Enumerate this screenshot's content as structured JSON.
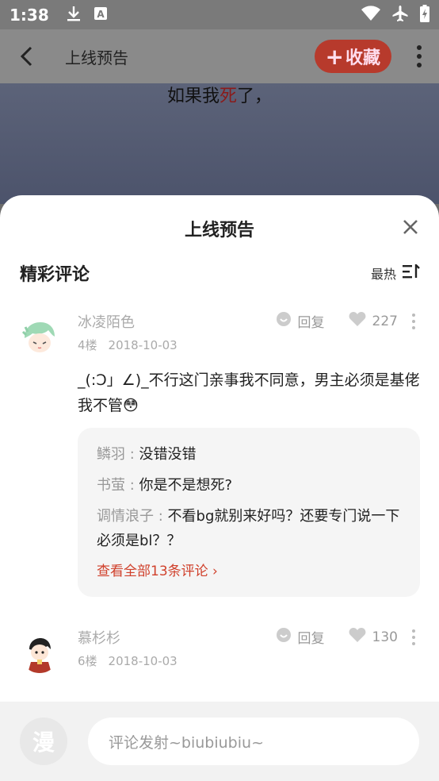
{
  "status_bar": {
    "time": "1:38"
  },
  "page": {
    "title": "上线预告",
    "fav_plus": "+",
    "fav_label": "收藏",
    "subtitle_pre": "如果我",
    "subtitle_red": "死",
    "subtitle_post": "了，"
  },
  "sheet": {
    "title": "上线预告",
    "section_title": "精彩评论",
    "sort_label": "最热"
  },
  "comments": [
    {
      "user": "冰凌陌色",
      "floor": "4楼",
      "date": "2018-10-03",
      "reply_label": "回复",
      "likes": "227",
      "text": "_(:Ɔ」∠)_不行这门亲事我不同意，男主必须是基佬我不管😳",
      "replies": [
        {
          "name": "鳞羽",
          "sep": " : ",
          "text": "没错没错"
        },
        {
          "name": "书萤",
          "sep": " : ",
          "text": "你是不是想死?"
        },
        {
          "name": "调情浪子",
          "sep": " : ",
          "text": "不看bg就别来好吗？还要专门说一下必须是bl？？"
        }
      ],
      "see_all": "查看全部13条评论 ›"
    },
    {
      "user": "慕杉杉",
      "floor": "6楼",
      "date": "2018-10-03",
      "reply_label": "回复",
      "likes": "130"
    }
  ],
  "bottom_bar": {
    "manga_icon_label": "漫",
    "input_placeholder": "评论发射~biubiubiu~"
  },
  "colors": {
    "accent": "#d0402b",
    "fav_bg": "#b73a2c"
  }
}
